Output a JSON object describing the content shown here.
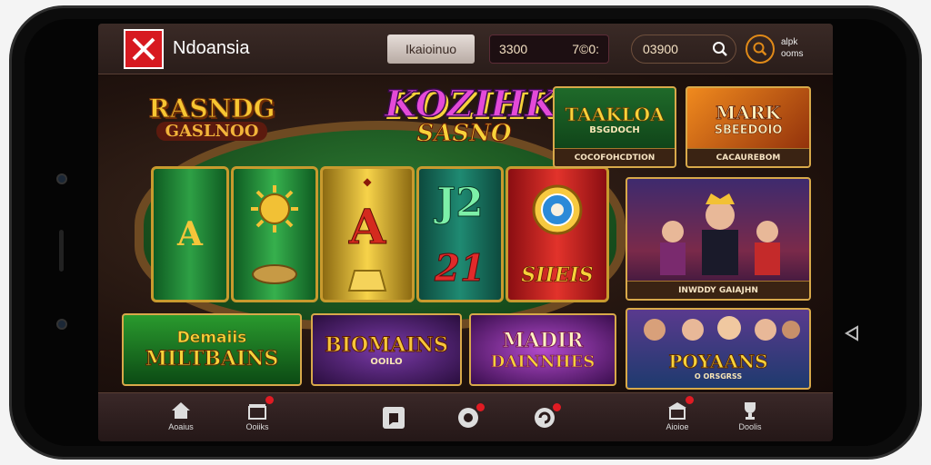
{
  "header": {
    "brand": "Ndoansia",
    "primary_button": "Ikaioinuo",
    "balance_left": "3300",
    "balance_right": "7©0:",
    "search_value": "03900",
    "user_line1": "alpk",
    "user_line2": "ooms"
  },
  "hero": {
    "logo_left_top": "RASNDG",
    "logo_left_bottom": "GASLNOO",
    "logo_center_top": "KOZIHK",
    "logo_center_bottom": "SASNO",
    "reel_symbols": [
      "A",
      "A",
      "J2",
      "21",
      "SIIEIS"
    ]
  },
  "tiles": [
    {
      "title": "TAAKLOA",
      "subtitle": "BSGDOCH",
      "caption": "COCOFOHCDTION"
    },
    {
      "title": "MARK",
      "subtitle": "SBEEDOIO",
      "caption": "CACAUREBOM"
    },
    {
      "caption": "INWDDY GAIAJHN"
    },
    {
      "title": "Demaiis",
      "subtitle": "MILTBAINS"
    },
    {
      "title": "BIOMAINS",
      "subtitle": "OOILO"
    },
    {
      "title": "MADIR",
      "subtitle": "DAINNHES"
    },
    {
      "title": "POYAANS",
      "subtitle": "O ORSGRSS"
    }
  ],
  "bottom_nav": [
    {
      "label": "Aoaius",
      "icon": "home-icon"
    },
    {
      "label": "Ooiiks",
      "icon": "gift-icon"
    },
    {
      "label": "",
      "icon": "chat-icon"
    },
    {
      "label": "",
      "icon": "settings-icon"
    },
    {
      "label": "",
      "icon": "refresh-icon"
    },
    {
      "label": "Aioioe",
      "icon": "store-icon"
    },
    {
      "label": "Doolis",
      "icon": "trophy-icon"
    }
  ],
  "colors": {
    "accent": "#e08a18",
    "brand_red": "#d71920",
    "badge": "#e01b23"
  }
}
